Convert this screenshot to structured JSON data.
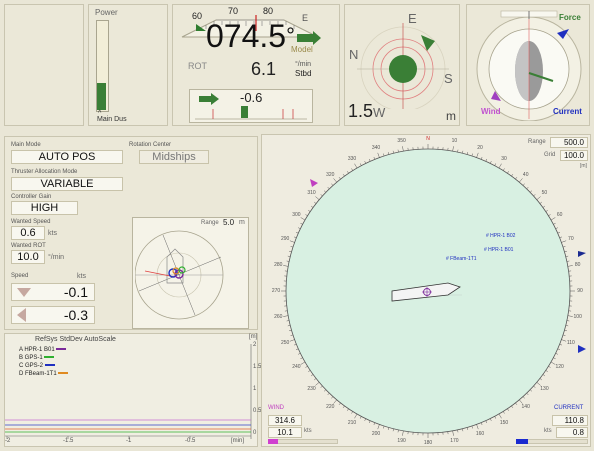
{
  "power": {
    "title": "Power",
    "source_label": "Main Dus",
    "level_fraction": 0.3
  },
  "heading": {
    "value": "074.5",
    "degree_symbol": "°",
    "scale_ticks": [
      "60",
      "70",
      "80"
    ],
    "cardinal": "E",
    "mode_label": "Model",
    "rot_label": "ROT",
    "rot_value": "6.1",
    "rot_unit": "°/min",
    "rot_direction": "Stbd",
    "rudder_value": "-0.6"
  },
  "compass": {
    "north": "N",
    "east": "E",
    "south": "S",
    "west": "W",
    "speed_value": "1.5",
    "speed_unit": "m"
  },
  "forces": {
    "force_label": "Force",
    "wind_label": "Wind",
    "current_label": "Current"
  },
  "controls": {
    "main_mode_label": "Main Mode",
    "main_mode_value": "AUTO POS",
    "rotation_center_label": "Rotation Center",
    "rotation_center_value": "Midships",
    "thruster_mode_label": "Thruster Allocation Mode",
    "thruster_mode_value": "VARIABLE",
    "gain_label": "Controller Gain",
    "gain_value": "HIGH",
    "wanted_speed_label": "Wanted Speed",
    "wanted_speed_value": "0.6",
    "wanted_speed_unit": "kts",
    "wanted_rot_label": "Wanted ROT",
    "wanted_rot_value": "10.0",
    "wanted_rot_unit": "°/min",
    "speed_label": "Speed",
    "speed_unit": "kts",
    "speed_surge": "-0.1",
    "speed_sway": "-0.3"
  },
  "mini_radar": {
    "range_label": "Range",
    "range_value": "5.0",
    "range_unit": "m"
  },
  "stddev": {
    "title": "RefSys StdDev AutoScale",
    "y_unit": "[m]",
    "x_unit": "[min]",
    "legend": [
      {
        "label": "A  HPR-1 B01",
        "color": "#7b2a9a"
      },
      {
        "label": "B  GPS-1",
        "color": "#2fb02f"
      },
      {
        "label": "C  GPS-2",
        "color": "#2030c0"
      },
      {
        "label": "D  FBeam-1T1",
        "color": "#e08a20"
      }
    ],
    "x_ticks": [
      "-2",
      "-1.5",
      "-1",
      "-0.5",
      "0"
    ],
    "y_ticks": [
      "2",
      "1.5",
      "1",
      "0.5",
      "0"
    ]
  },
  "position_plot": {
    "range_label": "Range",
    "range_value": "500.0",
    "grid_label": "Grid",
    "grid_value": "100.0",
    "grid_unit": "[m]",
    "bearing_labels": [
      "N",
      "10",
      "20",
      "30",
      "40",
      "50",
      "60",
      "70",
      "80",
      "90",
      "100",
      "110",
      "120",
      "130",
      "140",
      "150",
      "160",
      "170",
      "180",
      "190",
      "200",
      "210",
      "220",
      "230",
      "240",
      "250",
      "260",
      "270",
      "280",
      "290",
      "300",
      "310",
      "320",
      "330",
      "340",
      "350"
    ],
    "targets": [
      "# HPR-1 B02",
      "# HPR-1 B01",
      "# FBeam-1T1"
    ],
    "wind_label": "WIND",
    "wind_direction": "314.6",
    "wind_speed": "10.1",
    "wind_speed_unit": "kts",
    "current_label": "CURRENT",
    "current_direction": "110.8",
    "current_speed": "0.8",
    "current_speed_unit": "kts"
  }
}
